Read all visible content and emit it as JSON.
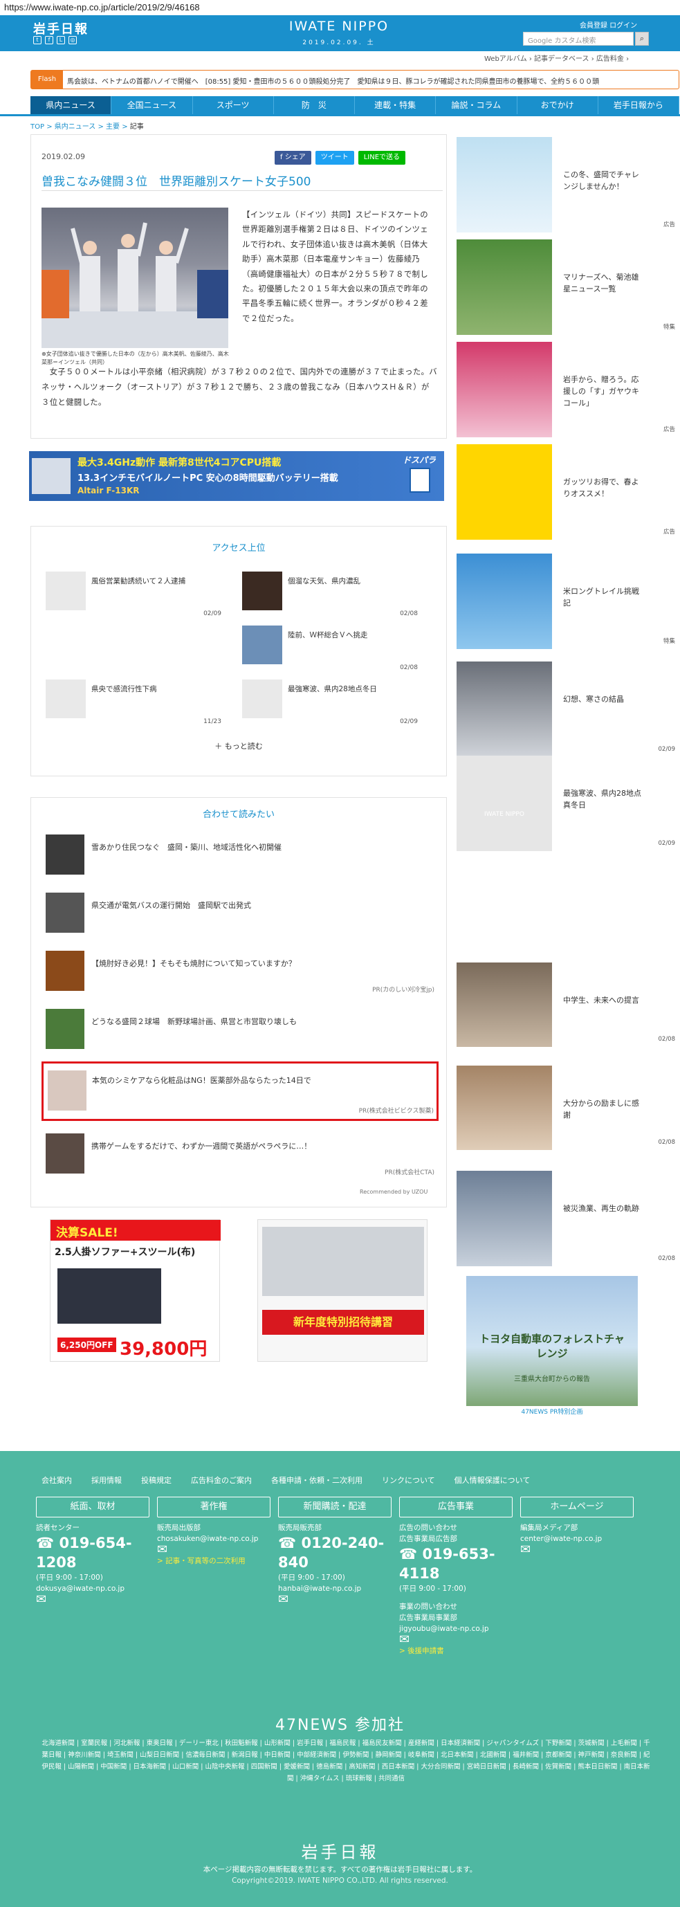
{
  "url": "https://www.iwate-np.co.jp/article/2019/2/9/46168",
  "header": {
    "logo": "岩手日報",
    "brand": "IWATE NIPPO",
    "date": "2019.02.09. 土",
    "member": "会員登録 ログイン",
    "search_placeholder": "Google カスタム検索",
    "sublinks": "Webアルバム › 記事データベース › 広告料金 ›"
  },
  "flash": {
    "tag": "Flash",
    "text": "馬会談は、ベトナムの首都ハノイで開催へ　[08:55] 愛知・豊田市の５６００頭殺処分完了　愛知県は９日、豚コレラが確認された同県豊田市の養豚場で、全約５６００頭"
  },
  "nav": [
    "県内ニュース",
    "全国ニュース",
    "スポーツ",
    "防　災",
    "連載・特集",
    "論説・コラム",
    "おでかけ",
    "岩手日報から"
  ],
  "crumb": {
    "top": "TOP",
    "c1": "県内ニュース",
    "c2": "主要",
    "cur": "記事"
  },
  "article": {
    "date": "2019.02.09",
    "title": "曽我こなみ健闘３位　世界距離別スケート女子500",
    "share": [
      "f シェア",
      "ツイート",
      "LINEで送る"
    ],
    "caption": "女子団体追い抜きで優勝した日本の（左から）高木美帆、佐藤綾乃、高木菜那＝インツェル（共同）",
    "body1": "【インツェル（ドイツ）共同】スピードスケートの世界距離別選手権第２日は８日、ドイツのインツェルで行われ、女子団体追い抜きは高木美帆（日体大助手）高木菜那（日本電産サンキョー）佐藤綾乃（高崎健康福祉大）の日本が２分５５秒７８で制した。初優勝した２０１５年大会以来の頂点で昨年の平昌冬季五輪に続く世界一。オランダが０秒４２差で２位だった。",
    "body2": "　女子５００メートルは小平奈緒（相沢病院）が３７秒２０の２位で、国内外での連勝が３７で止まった。バネッサ・ヘルツォーク（オーストリア）が３７秒１２で勝ち、２３歳の曽我こなみ（日本ハウスＨ＆Ｒ）が３位と健闘した。"
  },
  "banner": {
    "l1": "最大3.4GHz動作 最新第8世代4コアCPU搭載",
    "l2": "13.3インチモバイルノートPC 安心の8時間駆動バッテリー搭載",
    "l3": "Altair F-13KR",
    "brand": "ドスパラ"
  },
  "ranking": {
    "title": "アクセス上位",
    "items": [
      {
        "text": "風俗営業勧誘続いて２人逮捕",
        "date": "02/09"
      },
      {
        "text": "個溜な天気、県内濃乱",
        "date": "02/08"
      },
      {
        "text": "",
        "date": ""
      },
      {
        "text": "陸前、Ｗ杯総合Ｖへ挑走",
        "date": "02/08"
      },
      {
        "text": "県央で感流行性下病",
        "date": "11/23"
      },
      {
        "text": "最強寒波、県内28地点冬日",
        "date": "02/09"
      }
    ],
    "more": "もっと読む"
  },
  "related": {
    "title": "合わせて読みたい",
    "items": [
      {
        "text": "雪あかり住民つなぐ　盛岡・築川、地域活性化へ初開催",
        "pr": ""
      },
      {
        "text": "県交通が電気バスの運行開始　盛岡駅で出発式",
        "pr": ""
      },
      {
        "text": "【焼肘好き必見！】そもそも焼肘について知っていますか？",
        "pr": "PR(カのしい刈冷宝jp)"
      },
      {
        "text": "どうなる盛岡２球場　新野球場計画、県営と市営取り壊しも",
        "pr": ""
      },
      {
        "text": "本気のシミケアなら化粧品はNG！医薬部外品ならたった14日で",
        "pr": "PR(株式会社ビビクス製薬)"
      },
      {
        "text": "携帯ゲームをするだけで、わずか一週間で英語がペラペラに…！",
        "pr": "PR(株式会社CTA)"
      }
    ],
    "rec": "Recommended by UZOU"
  },
  "sidebar": [
    {
      "text": "この冬、盛岡でチャレンジしませんか！",
      "tag": "広告"
    },
    {
      "text": "マリナーズへ、菊池雄星ニュース一覧",
      "tag": "特集"
    },
    {
      "text": "岩手から、贈ろう。応援しの「す」ガヤウキコール」",
      "tag": "広告"
    },
    {
      "text": "ガッツリお得で、春よりオススメ！",
      "tag": "広告"
    },
    {
      "text": "米ロングトレイル挑戦記",
      "tag": "特集"
    },
    {
      "text": "幻想、寒さの結晶",
      "tag": "02/09"
    },
    {
      "text": "最強寒波、県内28地点真冬日",
      "tag": "02/09"
    },
    {
      "text": "中学生、未来への提言",
      "tag": "02/08"
    },
    {
      "text": "大分からの励ましに感謝",
      "tag": "02/08"
    },
    {
      "text": "被災漁業、再生の軌跡",
      "tag": "02/08"
    }
  ],
  "ads": {
    "sale": "決算SALE!",
    "sofa": "2.5人掛ソファー+スツール(布)",
    "price": "39,800円",
    "off": "6,250円OFF",
    "shop": "新年度特別招待講習",
    "forest": "トヨタ自動車のフォレストチャレンジ",
    "forest_sub": "三重県大台町からの報告",
    "forest_tag": "47NEWS PR特別企画"
  },
  "footer": {
    "links": [
      "会社案内",
      "採用情報",
      "投稿規定",
      "広告料金のご案内",
      "各種申請・依頼・二次利用",
      "リンクについて",
      "個人情報保護について"
    ],
    "buttons": [
      "紙面、取材",
      "著作権",
      "新聞購読・配達",
      "広告事業",
      "ホームページ"
    ],
    "c1": {
      "label": "読者センター",
      "phone": "019-654-1208",
      "hours": "(平日 9:00 - 17:00)",
      "mail": "dokusya@iwate-np.co.jp"
    },
    "c2": {
      "label": "販売局出版部",
      "mail": "chosakuken@iwate-np.co.jp",
      "link": "> 記事・写真等の二次利用"
    },
    "c3": {
      "label": "販売局販売部",
      "phone": "0120-240-840",
      "hours": "(平日 9:00 - 17:00)",
      "mail": "hanbai@iwate-np.co.jp"
    },
    "c4": {
      "label": "広告の問い合わせ",
      "label2": "広告事業局広告部",
      "phone": "019-653-4118",
      "hours": "(平日 9:00 - 17:00)",
      "label3": "事業の問い合わせ",
      "label4": "広告事業局事業部",
      "mail": "jigyoubu@iwate-np.co.jp",
      "link": "> 後援申請書"
    },
    "c5": {
      "label": "編集局メディア部",
      "mail": "center@iwate-np.co.jp"
    },
    "news47": "47NEWS 参加社",
    "papers": "北海道新聞 | 室蘭民報 | 河北新報 | 東奥日報 | デーリー東北 | 秋田魁新報 | 山形新聞 | 岩手日報 | 福島民報 | 福島民友新聞 | 産経新聞 | 日本経済新聞 | ジャパンタイムズ | 下野新聞 | 茨城新聞 | 上毛新聞 | 千葉日報 | 神奈川新聞 | 埼玉新聞 | 山梨日日新聞 | 信濃毎日新聞 | 新潟日報 | 中日新聞 | 中部経済新聞 | 伊勢新聞 | 静岡新聞 | 岐阜新聞 | 北日本新聞 | 北國新聞 | 福井新聞 | 京都新聞 | 神戸新聞 | 奈良新聞 | 紀伊民報 | 山陽新聞 | 中国新聞 | 日本海新聞 | 山口新聞 | 山陰中央新報 | 四国新聞 | 愛媛新聞 | 徳島新聞 | 高知新聞 | 西日本新聞 | 大分合同新聞 | 宮崎日日新聞 | 長崎新聞 | 佐賀新聞 | 熊本日日新聞 | 南日本新聞 | 沖縄タイムス | 琉球新報 | 共同通信",
    "logo": "岩手日報",
    "note": "本ページ掲載内容の無断転載を禁じます。すべての著作権は岩手日報社に属します。",
    "copy": "Copyright©2019. IWATE NIPPO CO.,LTD. All rights reserved."
  }
}
